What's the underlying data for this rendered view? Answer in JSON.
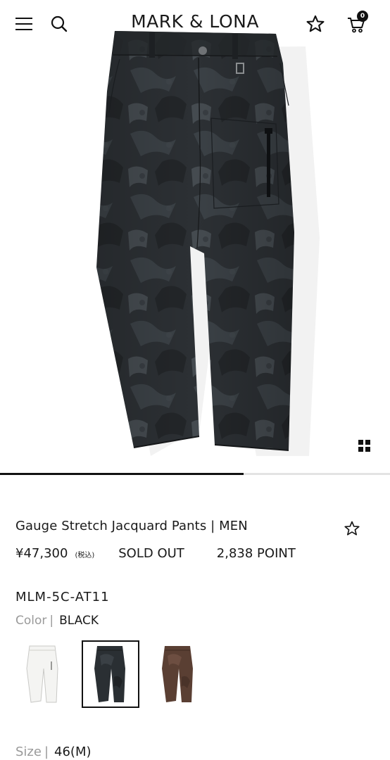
{
  "header": {
    "logo": "MARK & LONA",
    "cart_count": "0",
    "icons": [
      "hamburger-menu-icon",
      "search-icon",
      "star-outline-icon",
      "cart-icon"
    ]
  },
  "gallery": {
    "progress": 0.625,
    "view_toggle_icon": "grid-icon"
  },
  "product": {
    "name": "Gauge Stretch Jacquard Pants | MEN",
    "price": "¥47,300",
    "tax_note": "(税込)",
    "status": "SOLD OUT",
    "points": "2,838 POINT",
    "model_code": "MLM-5C-AT11",
    "color_label": "Color",
    "color_value": "BLACK",
    "size_label": "Size",
    "size_value": "46(M)"
  },
  "swatches": [
    {
      "color": "#f2f2f0",
      "selected": false
    },
    {
      "color": "#2a2f33",
      "selected": true
    },
    {
      "color": "#5a3f33",
      "selected": false
    }
  ]
}
